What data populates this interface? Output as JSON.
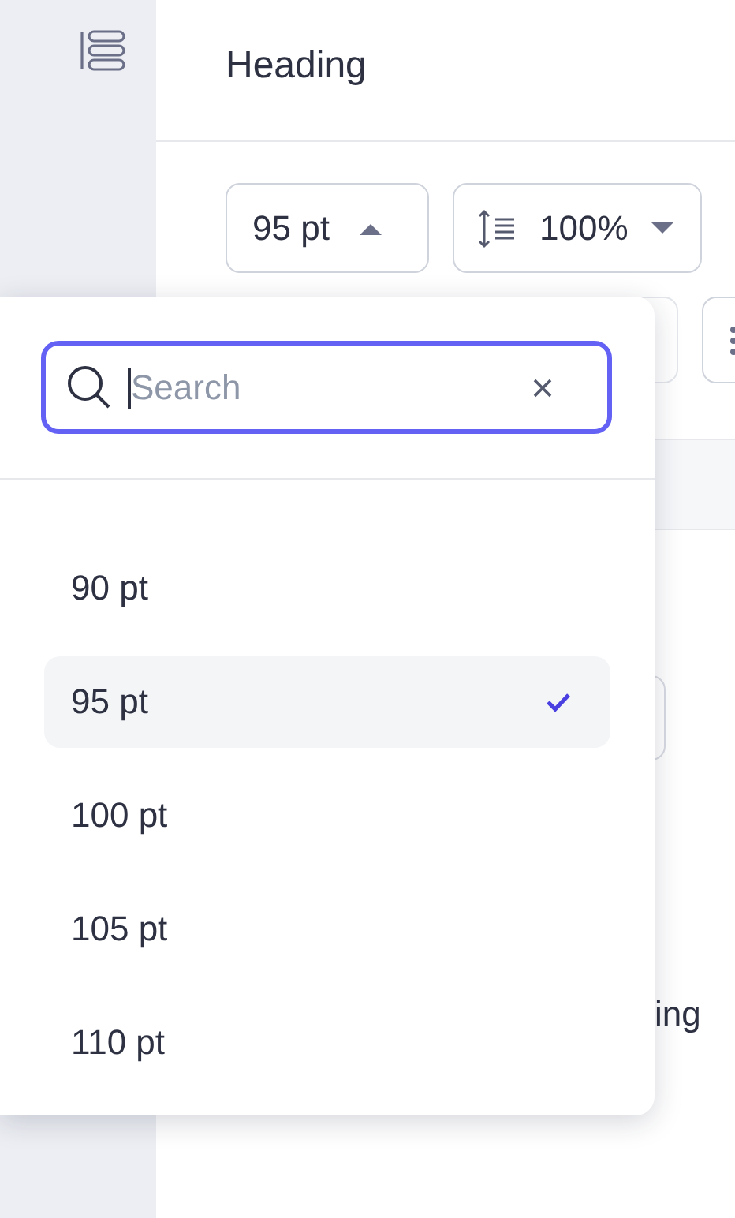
{
  "panel": {
    "title": "Heading"
  },
  "toolbar": [
    {
      "kind": "size",
      "label": "95 pt",
      "expanded": true
    },
    {
      "kind": "spacing",
      "label": "100%",
      "expanded": false
    }
  ],
  "hidden_text": [
    {
      "text": "ing"
    }
  ],
  "dropdown": {
    "search": {
      "placeholder": "Search"
    },
    "options": [
      {
        "label": "90 pt",
        "selected": false
      },
      {
        "label": "95 pt",
        "selected": true
      },
      {
        "label": "100 pt",
        "selected": false
      },
      {
        "label": "105 pt",
        "selected": false
      },
      {
        "label": "110 pt",
        "selected": false
      }
    ]
  }
}
